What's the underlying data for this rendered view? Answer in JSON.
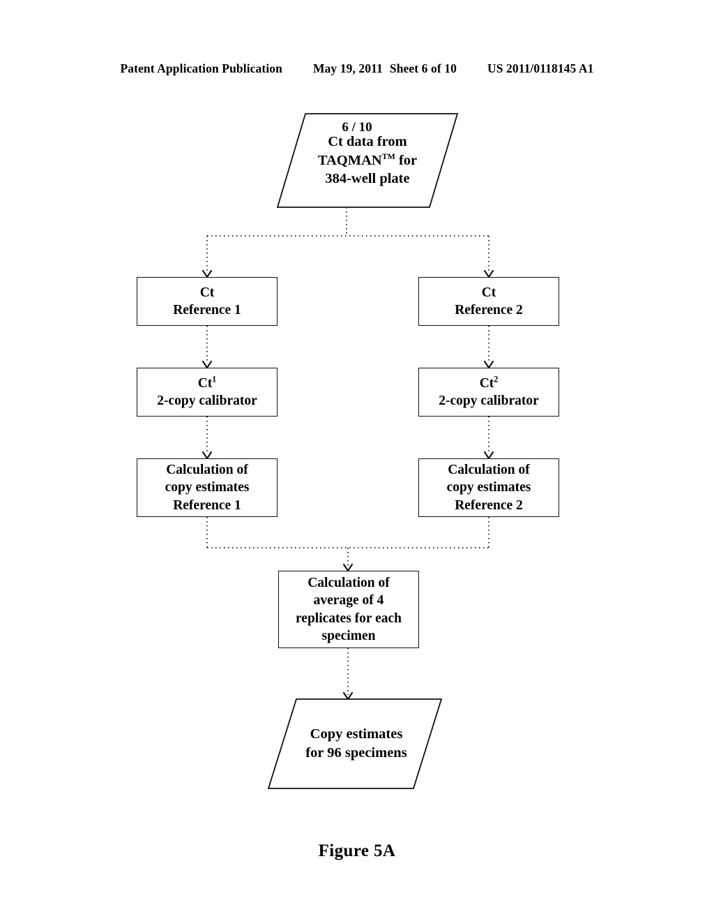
{
  "header": {
    "publication": "Patent Application Publication",
    "date": "May 19, 2011",
    "sheet": "Sheet 6 of 10",
    "patent_number": "US 2011/0118145 A1"
  },
  "page_marker": "6 / 10",
  "figure": {
    "caption": "Figure 5A",
    "line_color": "#111111",
    "connector_style": "dash-dot",
    "nodes": {
      "input_data": {
        "shape": "parallelogram",
        "line1": "Ct data from",
        "line2_pre": "TAQMAN",
        "line2_sup": "TM",
        "line2_post": " for",
        "line3": "384-well plate"
      },
      "ct_ref1": {
        "shape": "rect",
        "line1": "Ct",
        "line2": "Reference 1"
      },
      "ct_ref2": {
        "shape": "rect",
        "line1": "Ct",
        "line2": "Reference 2"
      },
      "calib1": {
        "shape": "rect",
        "line1_pre": "Ct",
        "line1_sup": "1",
        "line2": "2-copy calibrator"
      },
      "calib2": {
        "shape": "rect",
        "line1_pre": "Ct",
        "line1_sup": "2",
        "line2": "2-copy calibrator"
      },
      "calc_ref1": {
        "shape": "rect",
        "line1": "Calculation of",
        "line2": "copy estimates",
        "line3": "Reference 1"
      },
      "calc_ref2": {
        "shape": "rect",
        "line1": "Calculation of",
        "line2": "copy estimates",
        "line3": "Reference 2"
      },
      "average": {
        "shape": "rect",
        "line1": "Calculation of",
        "line2": "average of 4",
        "line3": "replicates for each",
        "line4": "specimen"
      },
      "output_data": {
        "shape": "parallelogram",
        "line1": "Copy estimates",
        "line2": "for 96 specimens"
      }
    }
  }
}
